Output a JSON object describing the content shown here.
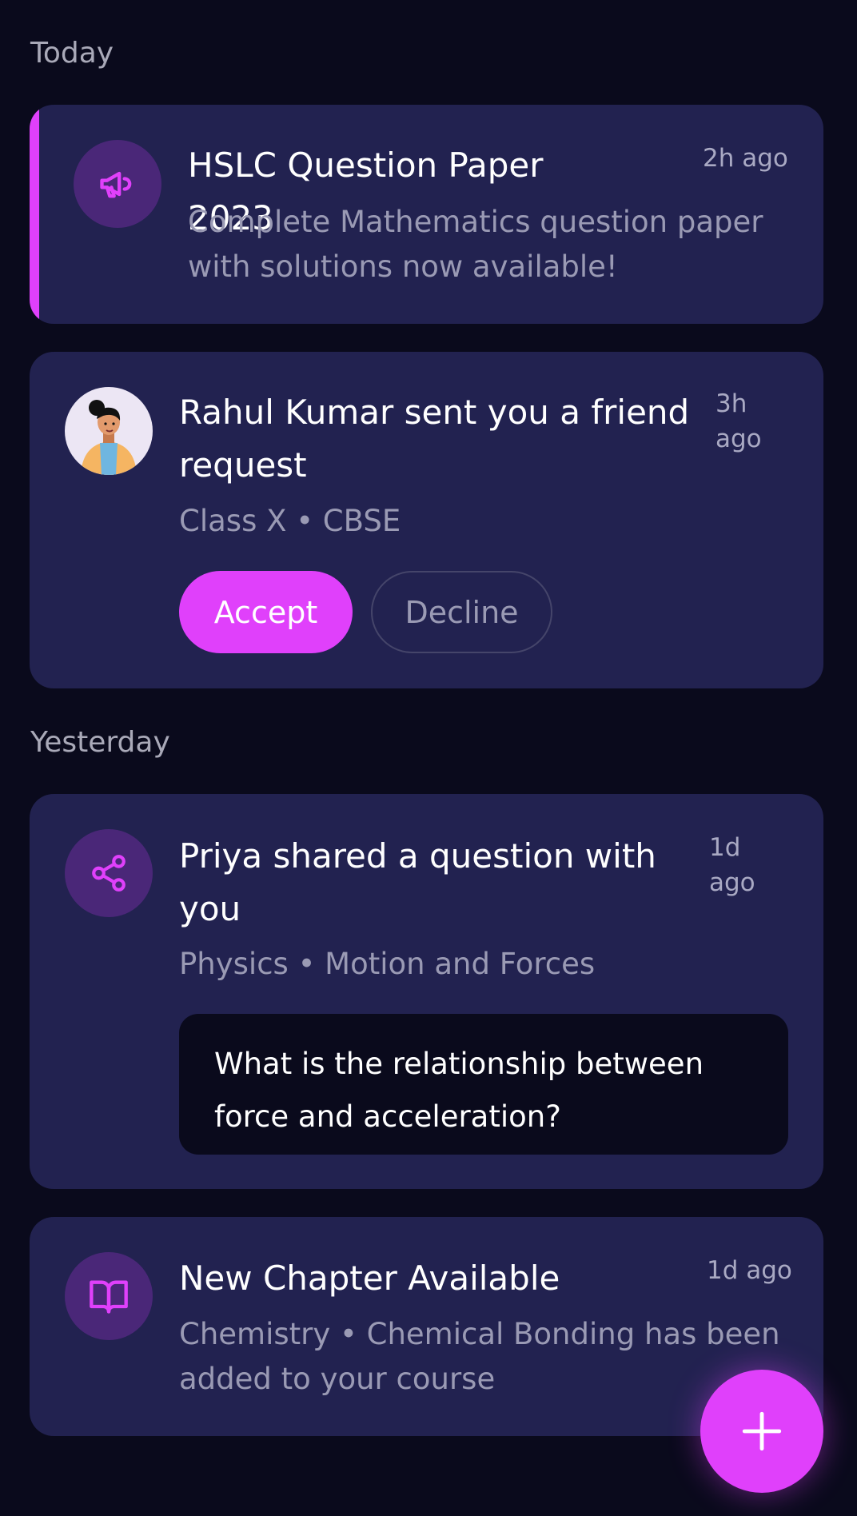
{
  "sections": {
    "today": "Today",
    "yesterday": "Yesterday"
  },
  "notifications": [
    {
      "icon": "megaphone-icon",
      "title": "HSLC Question Paper 2023",
      "time": "2h ago",
      "body": "Complete Mathematics question paper with solutions now available!"
    },
    {
      "icon": "avatar",
      "title": "Rahul Kumar sent you a friend request",
      "time": "3h ago",
      "subtitle": "Class X • CBSE",
      "accept_label": "Accept",
      "decline_label": "Decline"
    },
    {
      "icon": "share-icon",
      "title": "Priya shared a question with you",
      "time": "1d ago",
      "subtitle": "Physics • Motion and Forces",
      "question": "What is the relationship between force and acceleration?"
    },
    {
      "icon": "book-icon",
      "title": "New Chapter Available",
      "time": "1d ago",
      "body": "Chemistry • Chemical Bonding has been added to your course"
    }
  ],
  "fab": {
    "icon": "plus-icon"
  },
  "colors": {
    "background": "#0a0a1c",
    "card": "#222250",
    "accent": "#e040fb",
    "icon_circle": "#4a2778",
    "muted_text": "#9a9ab4"
  }
}
